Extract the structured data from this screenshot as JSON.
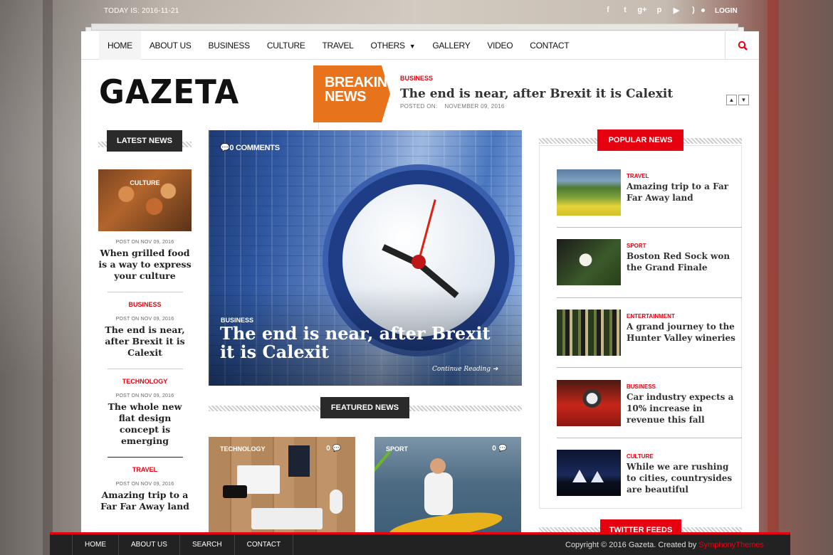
{
  "topbar": {
    "today": "TODAY IS: 2016-11-21",
    "login": "LOGIN",
    "social": [
      "f",
      "t",
      "g+",
      "p",
      "yt",
      "rss"
    ]
  },
  "nav": {
    "items": [
      "HOME",
      "ABOUT US",
      "BUSINESS",
      "CULTURE",
      "TRAVEL",
      "OTHERS",
      "GALLERY",
      "VIDEO",
      "CONTACT"
    ],
    "active": "HOME"
  },
  "logo": "GAZETA",
  "breaking": {
    "label_line1": "BREAKING",
    "label_line2": "NEWS",
    "category": "BUSINESS",
    "title": "The end is near, after Brexit it is Calexit",
    "posted_label": "POSTED ON:",
    "posted_date": "NOVEMBER 09, 2016"
  },
  "latest": {
    "heading": "LATEST NEWS",
    "items": [
      {
        "category": "CULTURE",
        "meta": "POST ON  NOV 09, 2016",
        "title": "When grilled food is a way to express your culture"
      },
      {
        "category": "BUSINESS",
        "meta": "POST ON  NOV 09, 2016",
        "title": "The end is near, after Brexit it is Calexit"
      },
      {
        "category": "TECHNOLOGY",
        "meta": "POST ON  NOV 09, 2016",
        "title": "The whole new flat design concept is emerging"
      },
      {
        "category": "TRAVEL",
        "meta": "POST ON  NOV 09, 2016",
        "title": "Amazing trip to a Far Far Away land"
      }
    ]
  },
  "hero": {
    "comments": "0 COMMENTS",
    "category": "BUSINESS",
    "title": "The end is near, after Brexit it is Calexit",
    "continue": "Continue Reading"
  },
  "featured": {
    "heading": "FEATURED NEWS",
    "items": [
      {
        "category": "TECHNOLOGY",
        "count": "0"
      },
      {
        "category": "SPORT",
        "count": "0"
      }
    ]
  },
  "popular": {
    "heading": "POPULAR NEWS",
    "items": [
      {
        "category": "TRAVEL",
        "title": "Amazing trip to a Far Far Away land"
      },
      {
        "category": "SPORT",
        "title": "Boston Red Sock won the Grand Finale"
      },
      {
        "category": "ENTERTAINMENT",
        "title": "A grand journey to the Hunter Valley wineries"
      },
      {
        "category": "BUSINESS",
        "title": "Car industry expects a 10% increase in revenue this fall"
      },
      {
        "category": "CULTURE",
        "title": "While we are rushing to cities, countrysides are beautiful"
      }
    ]
  },
  "twitter": {
    "heading": "TWITTER FEEDS"
  },
  "footer": {
    "nav": [
      "HOME",
      "ABOUT US",
      "SEARCH",
      "CONTACT"
    ],
    "copyright": "Copyright © 2016 Gazeta. Created by ",
    "creator": "SymphonyThemes"
  },
  "colors": {
    "accent": "#e7000f",
    "breaking": "#e8731d",
    "dark": "#2a2a2a"
  }
}
